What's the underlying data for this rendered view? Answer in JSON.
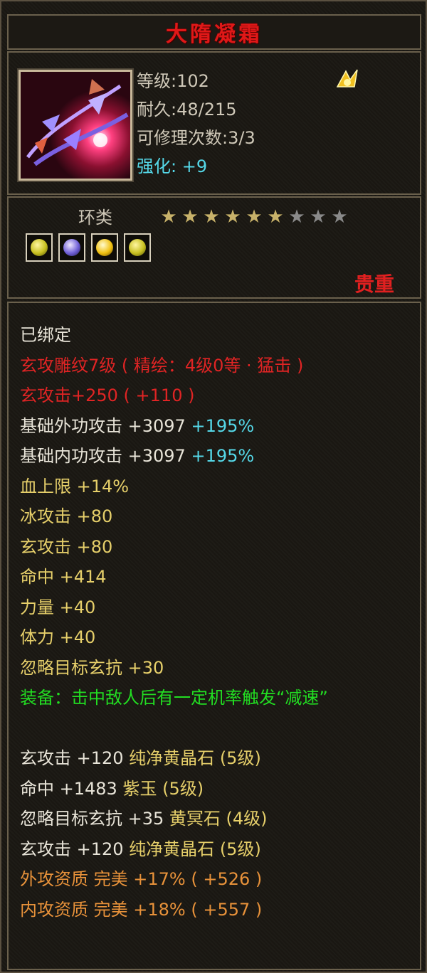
{
  "item": {
    "name": "大隋凝霜",
    "level": "等级:102",
    "durability": "耐久:48/215",
    "repairs": "可修理次数:3/3",
    "enhance": "强化: +9",
    "category": "环类",
    "stars": {
      "total": 9,
      "filled": 6
    },
    "gems": [
      {
        "icon": "yellow-gem-icon",
        "color": "#c8c020"
      },
      {
        "icon": "purple-gem-icon",
        "color": "#7060d8"
      },
      {
        "icon": "gold-gem-icon",
        "color": "#f0c010"
      },
      {
        "icon": "yellow-gem-icon",
        "color": "#c8c020"
      }
    ],
    "rarity": "贵重"
  },
  "stats": {
    "bound": "已绑定",
    "engrave": "玄攻雕纹7级 ( 精绘：4级0等 · 猛击 )",
    "xuan_atk_main": "玄攻击+250",
    "xuan_atk_bonus": " ( +110 )",
    "ext_atk": "基础外功攻击 +3097",
    "ext_atk_pct": " +195%",
    "int_atk": "基础内功攻击 +3097",
    "int_atk_pct": " +195%",
    "lines": [
      "血上限 +14%",
      "冰攻击 +80",
      "玄攻击 +80",
      "命中 +414",
      "力量 +40",
      "体力 +40",
      "忽略目标玄抗 +30"
    ],
    "equip_effect": "装备：击中敌人后有一定机率触发“减速”",
    "gem_lines": [
      {
        "prefix": "玄攻击 +120 ",
        "gem": "纯净黄晶石 (5级)"
      },
      {
        "prefix": "命中 +1483 ",
        "gem": "紫玉 (5级)"
      },
      {
        "prefix": "忽略目标玄抗 +35 ",
        "gem": "黄冥石 (4级)"
      },
      {
        "prefix": "玄攻击 +120 ",
        "gem": "纯净黄晶石 (5级)"
      }
    ],
    "ext_quality": "外攻资质   完美  +17% ( +526 )",
    "int_quality": "内攻资质   完美  +18% ( +557 )"
  },
  "colors": {
    "title": "#e01818",
    "white": "#e8e4d8",
    "red": "#e02424",
    "yellow": "#e6cf6a",
    "cyan": "#55d8e8",
    "green": "#22dd22",
    "orange": "#e8923a"
  }
}
